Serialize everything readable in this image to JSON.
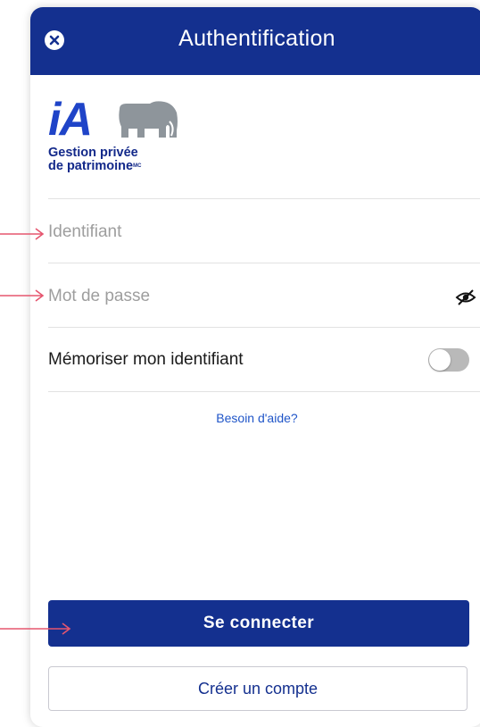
{
  "header": {
    "title": "Authentification",
    "close_icon": "close-icon"
  },
  "logo": {
    "brand": "iA",
    "line1": "Gestion privée",
    "line2": "de patrimoine",
    "trademark": "MC"
  },
  "form": {
    "username_placeholder": "Identifiant",
    "password_placeholder": "Mot de passe",
    "password_visibility_icon": "eye-off-icon",
    "remember_label": "Mémoriser mon identifiant",
    "remember_enabled": false
  },
  "help_link": "Besoin d'aide?",
  "buttons": {
    "login": "Se connecter",
    "create_account": "Créer un compte"
  },
  "annotations": {
    "arrow_color": "#e5566f"
  },
  "colors": {
    "brand_blue": "#14308f",
    "link_blue": "#1f55c8",
    "logo_blue": "#1f44c8",
    "elephant_gray": "#8e959b"
  }
}
